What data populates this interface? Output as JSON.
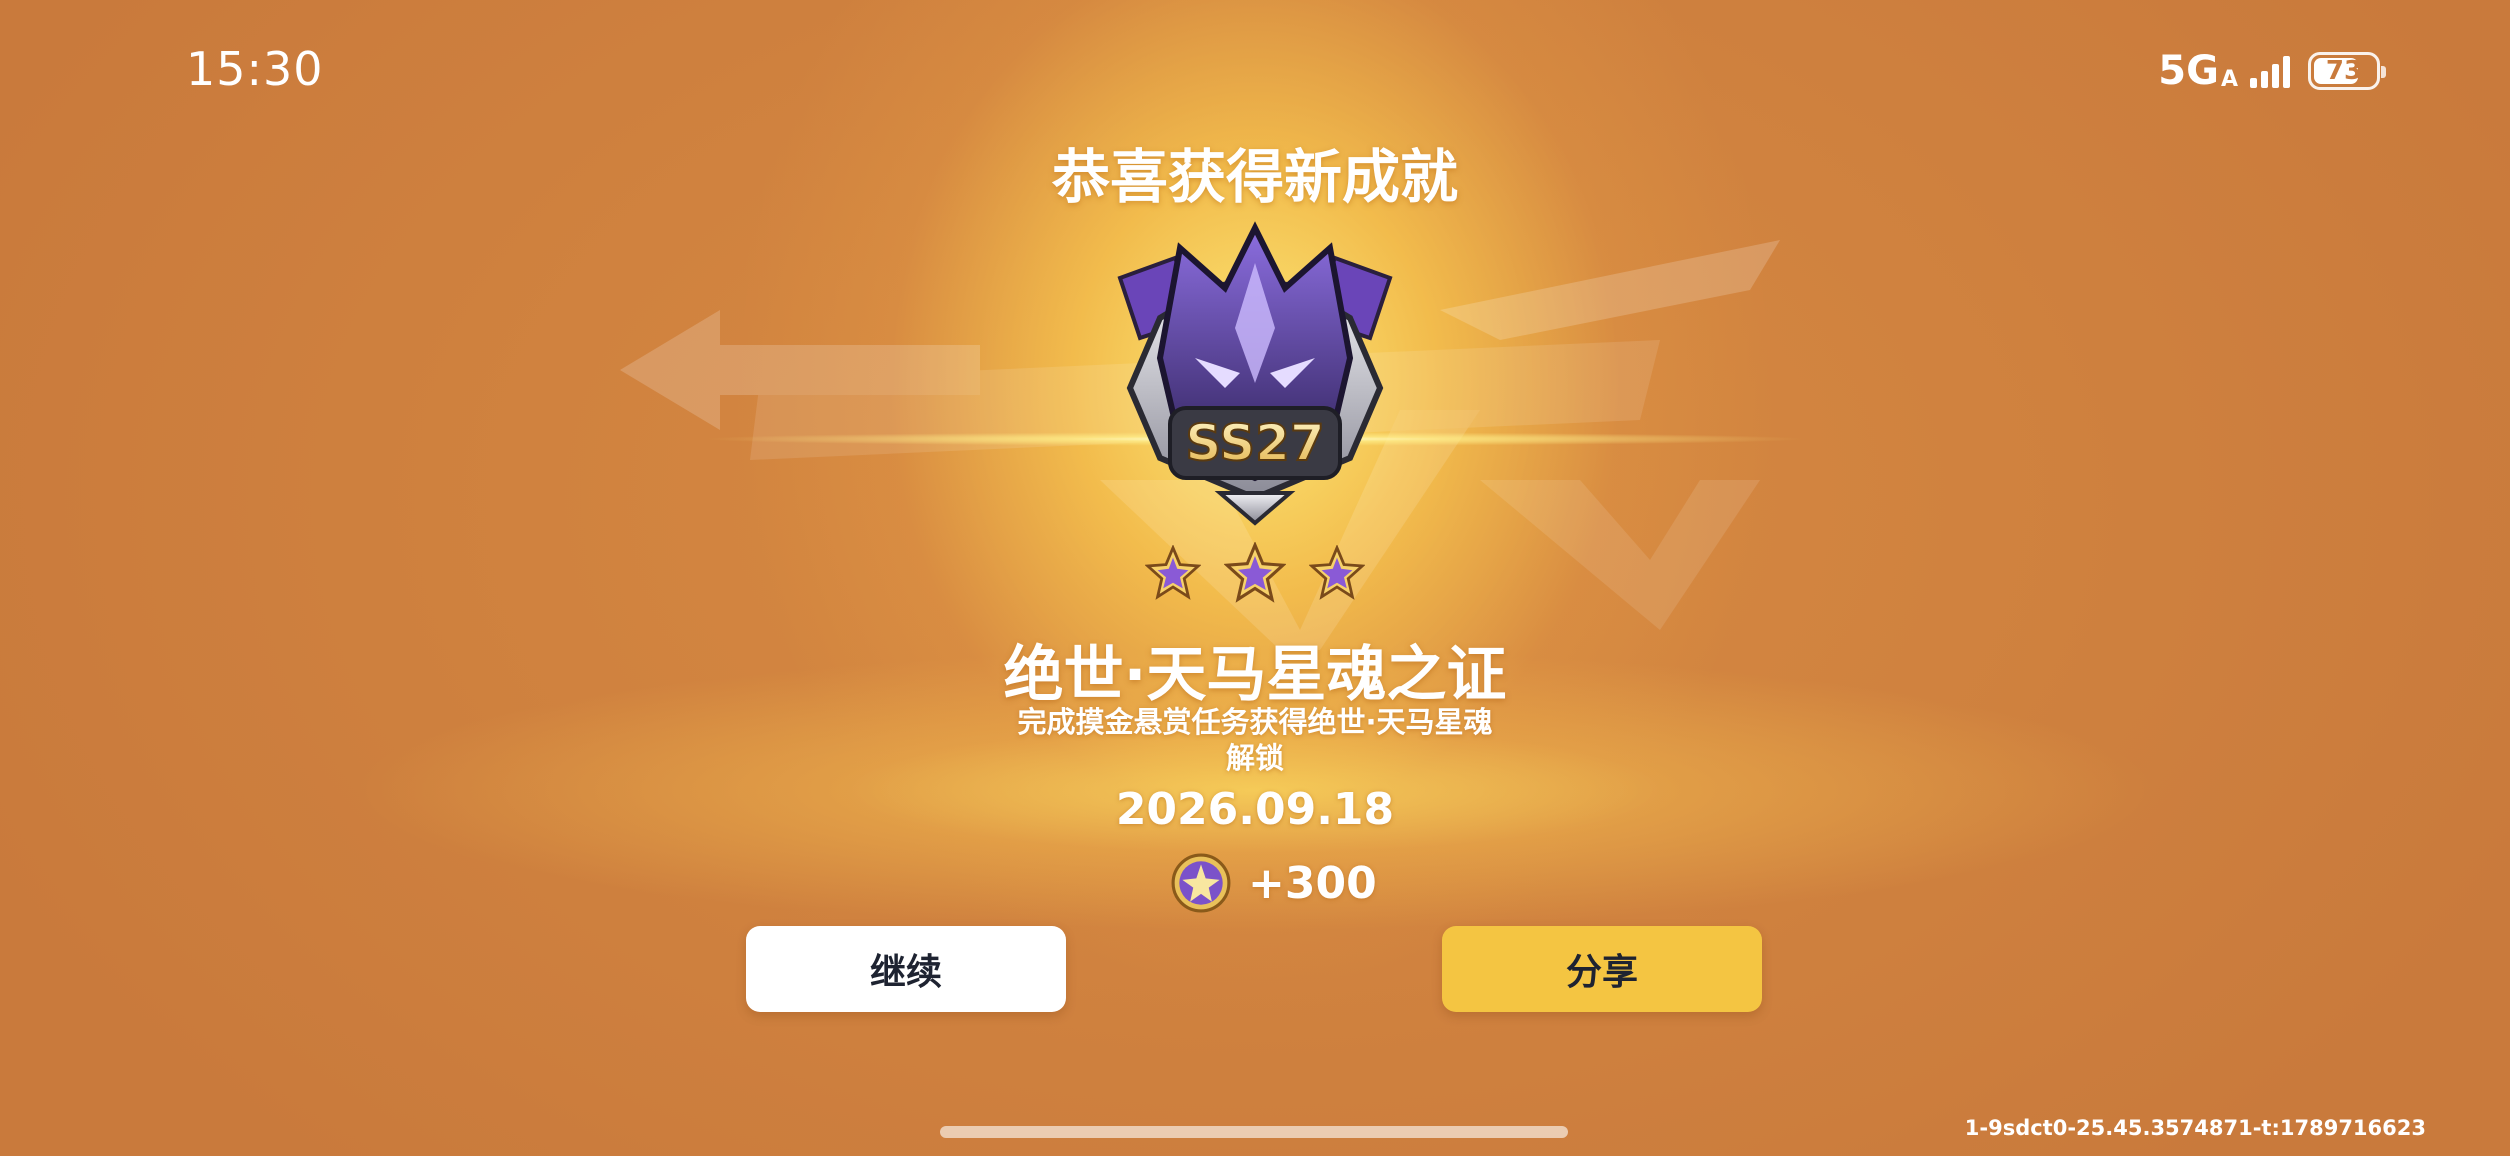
{
  "status_bar": {
    "time": "15:30",
    "network": "5G",
    "network_sub": "A",
    "battery": "73",
    "battery_level": 0.73
  },
  "achievement": {
    "headline": "恭喜获得新成就",
    "badge_label": "SS27",
    "star_count": 3,
    "title": "绝世·天马星魂之证",
    "description_line1": "完成摸金悬赏任务获得绝世·天马星魂",
    "description_line2": "解锁",
    "date": "2026.09.18",
    "reward_icon": "star-coin-icon",
    "reward_amount": "+300"
  },
  "buttons": {
    "continue_label": "继续",
    "share_label": "分享"
  },
  "footer": {
    "build_id": "1-9sdct0-25.45.3574871-t:1789716623"
  },
  "colors": {
    "background": "#c97a3c",
    "glow": "#ffe878",
    "share_button": "#f4c542",
    "continue_button": "#ffffff",
    "button_text": "#1e2331",
    "badge_purple": "#6a45b8"
  }
}
